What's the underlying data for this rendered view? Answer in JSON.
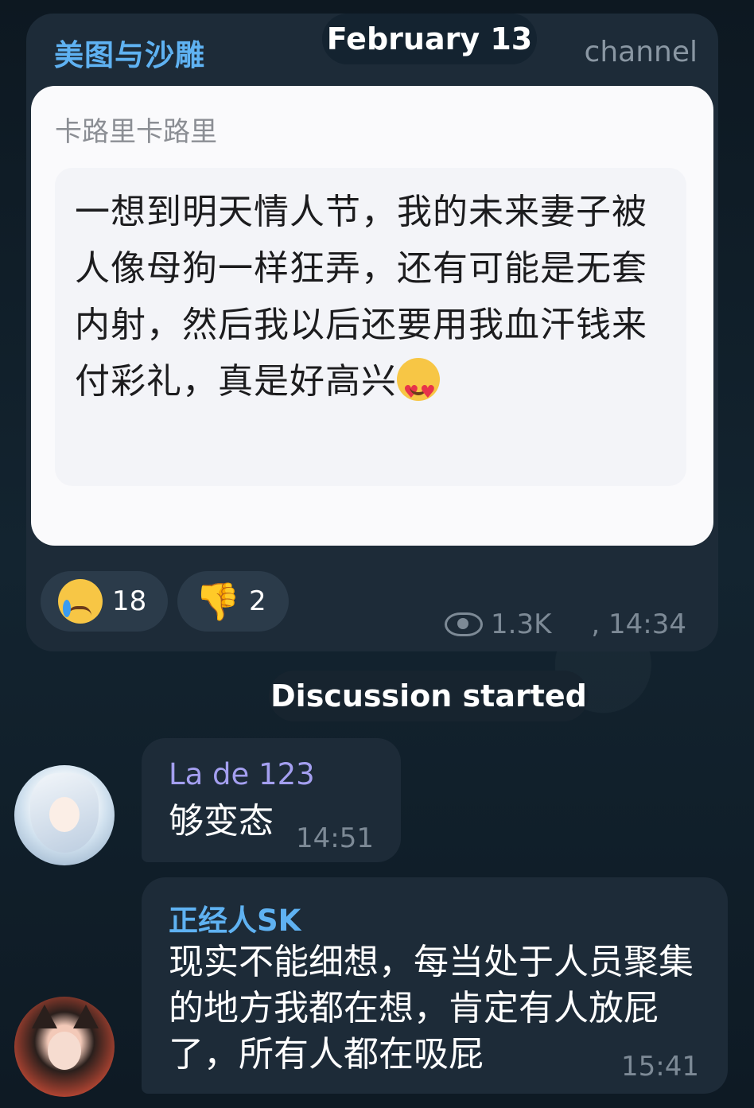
{
  "post": {
    "channel_name": "美图与沙雕",
    "date": "February 13",
    "channel_label": "channel",
    "photo": {
      "header": "卡路里卡路里",
      "text": "一想到明天情人节，我的未来妻子被人像母狗一样狂弄，还有可能是无套内射，然后我以后还要用我血汗钱来付彩礼，真是好高兴",
      "emoji": "heart-eyes-emoji"
    },
    "reactions": [
      {
        "emoji": "crying-face-emoji",
        "count": "18"
      },
      {
        "emoji": "thumbs-down-emoji",
        "count": "2"
      }
    ],
    "views": "1.3K",
    "time": ", 14:34"
  },
  "discussion": {
    "label": "Discussion started",
    "messages": [
      {
        "sender": "La de 123",
        "text": "够变态",
        "time": "14:51"
      },
      {
        "sender": "正经人SK",
        "text": "现实不能细想，每当处于人员聚集的地方我都在想，肯定有人放屁了，所有人都在吸屁",
        "time": "15:41"
      }
    ]
  },
  "colors": {
    "background": "#0f1b25",
    "bubble": "#1d2b38",
    "accent_blue": "#5fb2f2",
    "sender_purple": "#a49ff0",
    "meta_gray": "#7d8a96"
  }
}
